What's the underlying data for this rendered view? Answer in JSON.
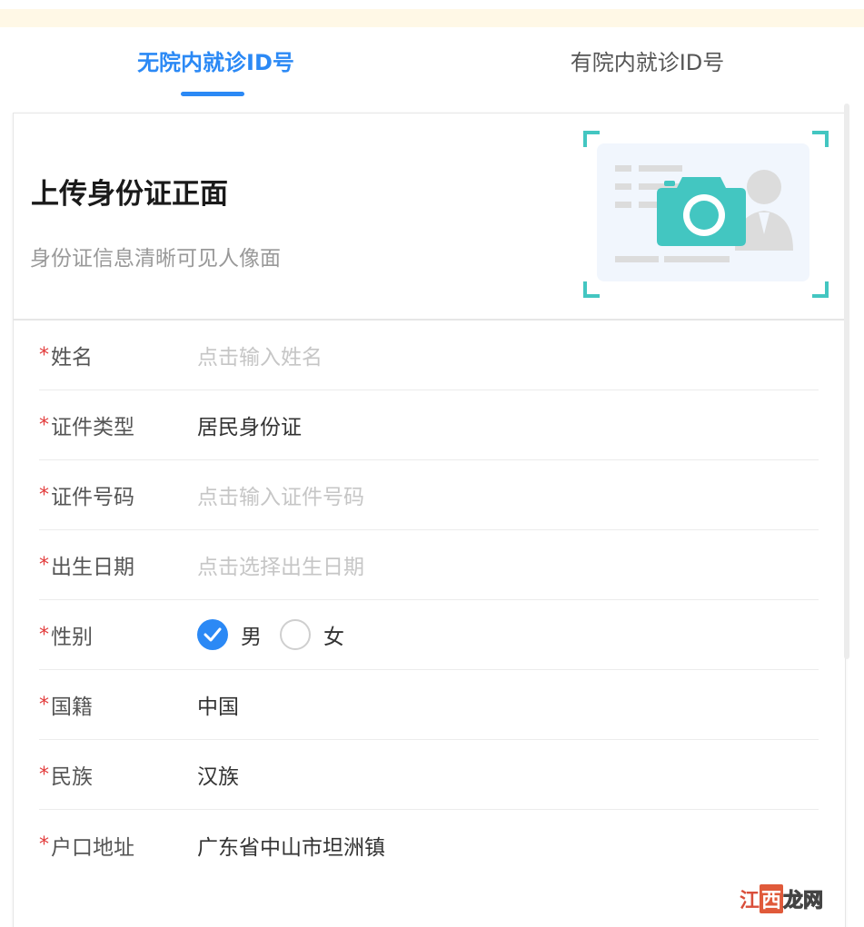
{
  "tabs": [
    {
      "label": "无院内就诊ID号",
      "active": true
    },
    {
      "label": "有院内就诊ID号",
      "active": false
    }
  ],
  "upload": {
    "title": "上传身份证正面",
    "subtitle": "身份证信息清晰可见人像面",
    "icon": "camera-icon"
  },
  "form": {
    "required_mark": "*",
    "name": {
      "label": "姓名",
      "placeholder": "点击输入姓名"
    },
    "id_type": {
      "label": "证件类型",
      "value": "居民身份证"
    },
    "id_number": {
      "label": "证件号码",
      "placeholder": "点击输入证件号码"
    },
    "birth_date": {
      "label": "出生日期",
      "placeholder": "点击选择出生日期"
    },
    "gender": {
      "label": "性别",
      "options": [
        "男",
        "女"
      ],
      "selected": "男"
    },
    "nationality": {
      "label": "国籍",
      "value": "中国"
    },
    "ethnicity": {
      "label": "民族",
      "value": "汉族"
    },
    "address": {
      "label": "户口地址",
      "value": "广东省中山市坦洲镇"
    }
  },
  "watermark": {
    "part1": "江",
    "part2": "西",
    "part3": "龙网"
  },
  "colors": {
    "accent": "#2b89f5",
    "teal": "#43c6c1",
    "required": "#e23b3b",
    "notice": "#fff8e6"
  }
}
